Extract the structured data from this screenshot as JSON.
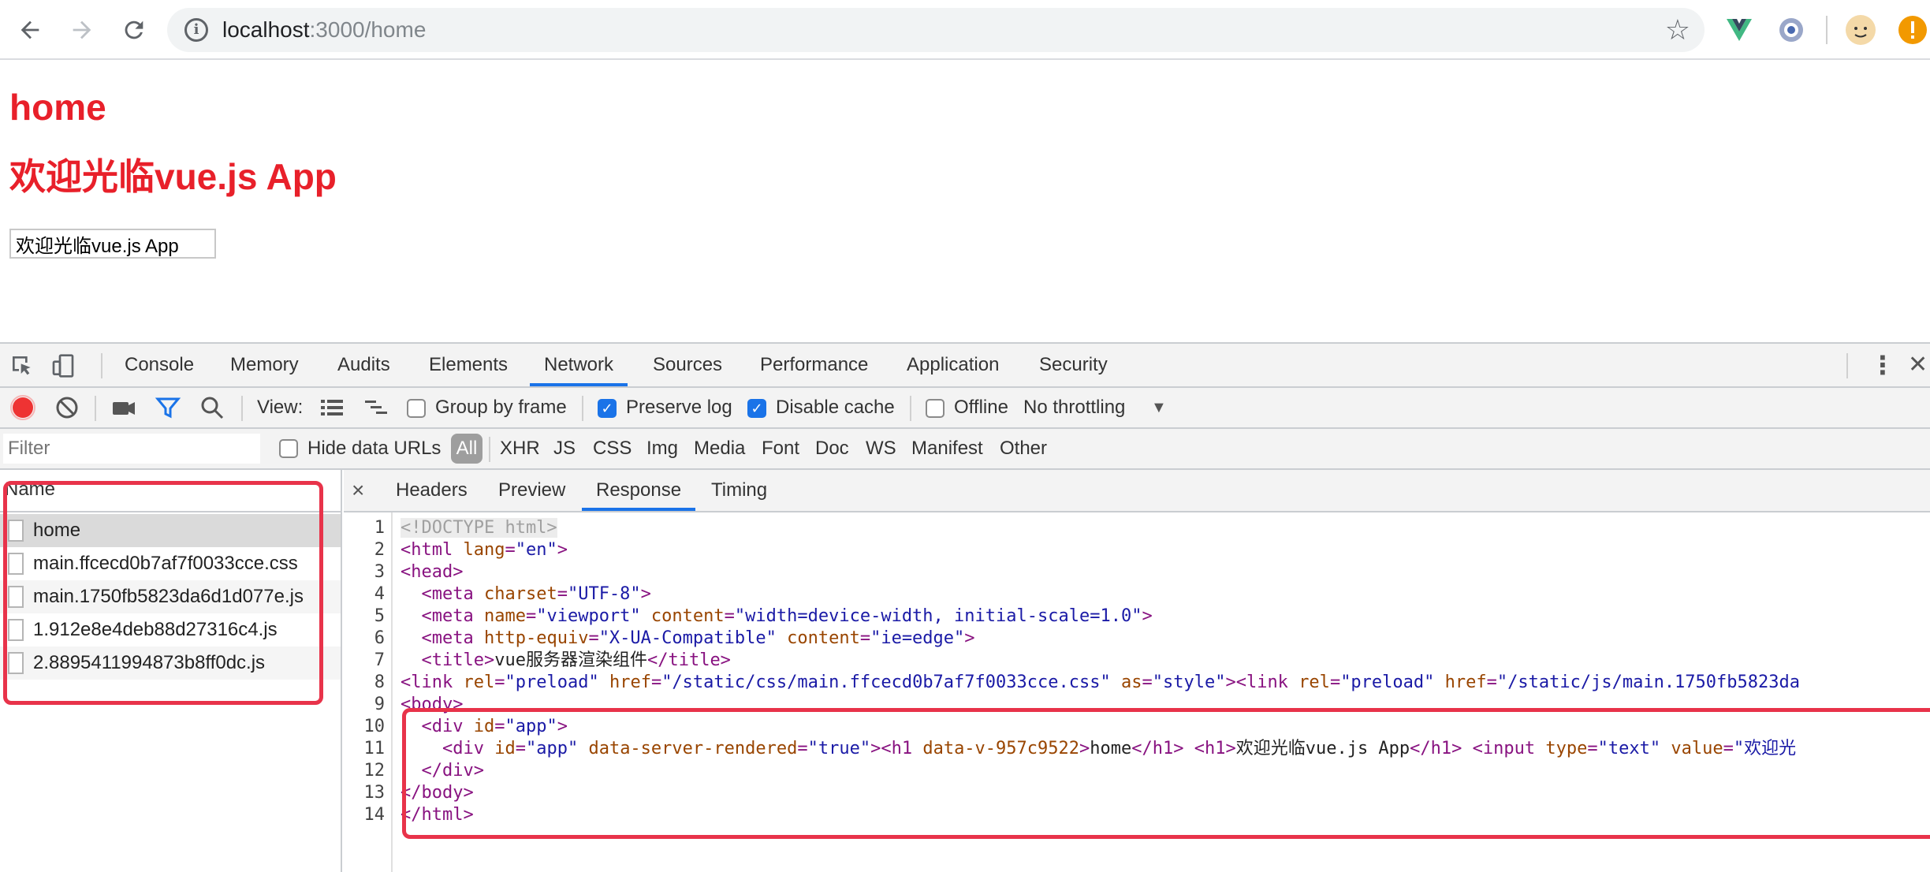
{
  "browser": {
    "url_host": "localhost",
    "url_path": ":3000/home",
    "back_icon": "back-arrow-icon",
    "forward_icon": "forward-arrow-icon",
    "reload_icon": "reload-icon",
    "bookmark_icon": "star-icon"
  },
  "page": {
    "heading": "home",
    "welcome": "欢迎光临vue.js App",
    "input_value": "欢迎光临vue.js App"
  },
  "devtools": {
    "tabs": [
      "Console",
      "Memory",
      "Audits",
      "Elements",
      "Network",
      "Sources",
      "Performance",
      "Application",
      "Security"
    ],
    "active_tab": "Network",
    "toolbar": {
      "view_label": "View:",
      "group_by_frame": "Group by frame",
      "preserve_log": "Preserve log",
      "disable_cache": "Disable cache",
      "offline": "Offline",
      "throttling": "No throttling"
    },
    "filter": {
      "placeholder": "Filter",
      "hide_data_urls": "Hide data URLs",
      "types": [
        "All",
        "XHR",
        "JS",
        "CSS",
        "Img",
        "Media",
        "Font",
        "Doc",
        "WS",
        "Manifest",
        "Other"
      ]
    },
    "requests": {
      "header": "Name",
      "items": [
        "home",
        "main.ffcecd0b7af7f0033cce.css",
        "main.1750fb5823da6d1d077e.js",
        "1.912e8e4deb88d27316c4.js",
        "2.8895411994873b8ff0dc.js"
      ]
    },
    "detail": {
      "close": "×",
      "tabs": [
        "Headers",
        "Preview",
        "Response",
        "Timing"
      ],
      "active_tab": "Response"
    },
    "response_lines": [
      "1",
      "2",
      "3",
      "4",
      "5",
      "6",
      "7",
      "8",
      "9",
      "10",
      "11",
      "12",
      "13",
      "14"
    ],
    "code": {
      "doctype": "<!DOCTYPE html>",
      "html_open_a": "<html ",
      "html_lang_attr": "lang",
      "html_lang_val": "\"en\"",
      "html_open_b": ">",
      "head_open": "<head>",
      "meta": "<meta ",
      "charset_attr": "charset",
      "charset_val": "\"UTF-8\"",
      "close_gt": ">",
      "name_attr": "name",
      "name_val": "\"viewport\"",
      "content_attr": "content",
      "content_val": "\"width=device-width, initial-scale=1.0\"",
      "httpequiv_attr": "http-equiv",
      "httpequiv_val": "\"X-UA-Compatible\"",
      "content_val2": "\"ie=edge\"",
      "title_open": "<title>",
      "title_text": "vue服务器渲染组件",
      "title_close": "</title>",
      "link_open": "<link ",
      "rel_attr": "rel",
      "rel_val": "\"preload\"",
      "href_attr": "href",
      "href_val_css": "\"/static/css/main.ffcecd0b7af7f0033cce.css\"",
      "as_attr": "as",
      "as_val": "\"style\"",
      "href_val_js": "\"/static/js/main.1750fb5823da",
      "body_open": "<body>",
      "div_open": "<div ",
      "id_attr": "id",
      "id_val": "\"app\"",
      "dsr_attr": "data-server-rendered",
      "dsr_val": "\"true\"",
      "h1_open_a": "<h1 ",
      "h1_datav": "data-v-957c9522",
      "h1_home": "home",
      "h1_close": "</h1>",
      "h1_open": "<h1>",
      "h1_welcome": "欢迎光临vue.js App",
      "input_open": "<input ",
      "type_attr": "type",
      "type_val": "\"text\"",
      "value_attr": "value",
      "value_val": "\"欢迎光",
      "div_close": "</div>",
      "body_close": "</body>",
      "html_close": "</html>",
      "eq": "="
    }
  },
  "colors": {
    "page_heading": "#e8202a",
    "annotation": "#e8334a",
    "active_tab_underline": "#1a73e8",
    "tag": "#881280",
    "attr_name": "#994500",
    "attr_value": "#1a1aa6"
  }
}
